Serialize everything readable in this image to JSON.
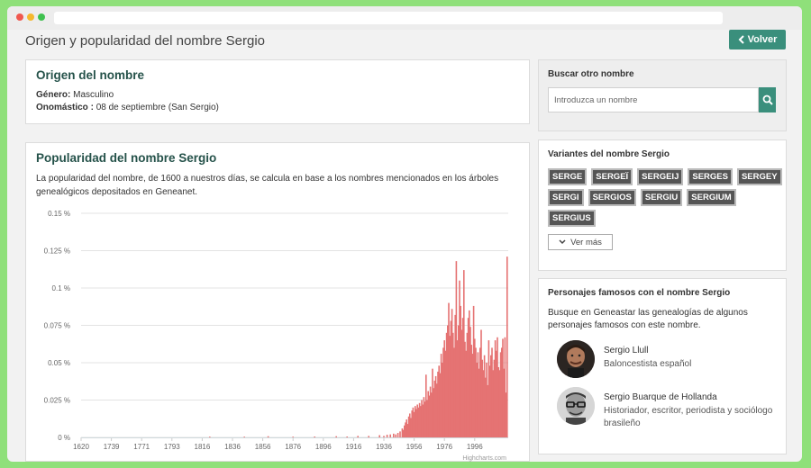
{
  "page": {
    "title": "Origen y popularidad del nombre Sergio",
    "back_label": "Volver"
  },
  "origin": {
    "title": "Origen del nombre",
    "gender_label": "Género:",
    "gender_value": "Masculino",
    "onomastic_label": "Onomástico :",
    "onomastic_value": "08 de septiembre (San Sergio)"
  },
  "popularity": {
    "title": "Popularidad del nombre Sergio",
    "description": "La popularidad del nombre, de 1600 a nuestros días, se calcula en base a los nombres mencionados en los árboles genealógicos depositados en Geneanet.",
    "credit": "Highcharts.com"
  },
  "search": {
    "title": "Buscar otro nombre",
    "placeholder": "Introduzca un nombre"
  },
  "variants": {
    "title": "Variantes del nombre Sergio",
    "items": [
      "SERGE",
      "SERGEÏ",
      "SERGEIJ",
      "SERGES",
      "SERGEY",
      "SERGI",
      "SERGIOS",
      "SERGIU",
      "SERGIUM",
      "SERGIUS"
    ],
    "more_label": "Ver más"
  },
  "famous": {
    "title": "Personajes famosos con el nombre Sergio",
    "description": "Busque en Geneastar las genealogías de algunos personajes famosos con este nombre.",
    "people": [
      {
        "name": "Sergio Llull",
        "desc": "Baloncestista español"
      },
      {
        "name": "Sergio Buarque de Hollanda",
        "desc": "Historiador, escritor, periodista y sociólogo brasileño"
      }
    ]
  },
  "colors": {
    "accent": "#3a8f7c",
    "bar": "#e57373",
    "title": "#25524a"
  },
  "chart_data": {
    "type": "bar",
    "x_range": [
      1620,
      2015
    ],
    "y_range": [
      0,
      0.15
    ],
    "y_ticks": [
      "0 %",
      "0.025 %",
      "0.05 %",
      "0.075 %",
      "0.1 %",
      "0.125 %",
      "0.15 %"
    ],
    "x_ticks": [
      "1620",
      "1739",
      "1771",
      "1793",
      "1816",
      "1836",
      "1856",
      "1876",
      "1896",
      "1916",
      "1936",
      "1956",
      "1976",
      "1996"
    ],
    "series": [
      {
        "values": [
          [
            1739,
            0.0005
          ],
          [
            1771,
            0.0005
          ],
          [
            1793,
            0.0008
          ],
          [
            1816,
            0.0005
          ],
          [
            1836,
            0.0006
          ],
          [
            1856,
            0.0008
          ],
          [
            1866,
            0.0006
          ],
          [
            1876,
            0.001
          ],
          [
            1886,
            0.001
          ],
          [
            1896,
            0.0015
          ],
          [
            1900,
            0.001
          ],
          [
            1903,
            0.0018
          ],
          [
            1906,
            0.002
          ],
          [
            1909,
            0.0025
          ],
          [
            1911,
            0.002
          ],
          [
            1913,
            0.003
          ],
          [
            1915,
            0.004
          ],
          [
            1917,
            0.006
          ],
          [
            1918,
            0.005
          ],
          [
            1919,
            0.008
          ],
          [
            1920,
            0.01
          ],
          [
            1921,
            0.012
          ],
          [
            1922,
            0.009
          ],
          [
            1923,
            0.014
          ],
          [
            1924,
            0.016
          ],
          [
            1925,
            0.013
          ],
          [
            1926,
            0.018
          ],
          [
            1927,
            0.02
          ],
          [
            1928,
            0.017
          ],
          [
            1929,
            0.021
          ],
          [
            1930,
            0.019
          ],
          [
            1931,
            0.022
          ],
          [
            1932,
            0.02
          ],
          [
            1933,
            0.023
          ],
          [
            1934,
            0.021
          ],
          [
            1935,
            0.025
          ],
          [
            1936,
            0.022
          ],
          [
            1937,
            0.027
          ],
          [
            1938,
            0.024
          ],
          [
            1939,
            0.042
          ],
          [
            1940,
            0.025
          ],
          [
            1941,
            0.031
          ],
          [
            1942,
            0.028
          ],
          [
            1943,
            0.034
          ],
          [
            1944,
            0.03
          ],
          [
            1945,
            0.046
          ],
          [
            1946,
            0.033
          ],
          [
            1947,
            0.038
          ],
          [
            1948,
            0.041
          ],
          [
            1949,
            0.036
          ],
          [
            1950,
            0.044
          ],
          [
            1951,
            0.048
          ],
          [
            1952,
            0.043
          ],
          [
            1953,
            0.056
          ],
          [
            1954,
            0.05
          ],
          [
            1955,
            0.06
          ],
          [
            1956,
            0.065
          ],
          [
            1957,
            0.058
          ],
          [
            1958,
            0.07
          ],
          [
            1959,
            0.075
          ],
          [
            1960,
            0.09
          ],
          [
            1961,
            0.068
          ],
          [
            1962,
            0.078
          ],
          [
            1963,
            0.086
          ],
          [
            1964,
            0.07
          ],
          [
            1965,
            0.06
          ],
          [
            1966,
            0.082
          ],
          [
            1967,
            0.118
          ],
          [
            1968,
            0.065
          ],
          [
            1969,
            0.075
          ],
          [
            1970,
            0.105
          ],
          [
            1971,
            0.088
          ],
          [
            1972,
            0.072
          ],
          [
            1973,
            0.08
          ],
          [
            1974,
            0.112
          ],
          [
            1975,
            0.064
          ],
          [
            1976,
            0.058
          ],
          [
            1977,
            0.07
          ],
          [
            1978,
            0.08
          ],
          [
            1979,
            0.085
          ],
          [
            1980,
            0.074
          ],
          [
            1981,
            0.062
          ],
          [
            1982,
            0.056
          ],
          [
            1983,
            0.088
          ],
          [
            1984,
            0.066
          ],
          [
            1985,
            0.06
          ],
          [
            1986,
            0.05
          ],
          [
            1987,
            0.057
          ],
          [
            1988,
            0.046
          ],
          [
            1989,
            0.06
          ],
          [
            1990,
            0.072
          ],
          [
            1991,
            0.052
          ],
          [
            1992,
            0.045
          ],
          [
            1993,
            0.055
          ],
          [
            1994,
            0.04
          ],
          [
            1995,
            0.05
          ],
          [
            1996,
            0.035
          ],
          [
            1997,
            0.065
          ],
          [
            1998,
            0.048
          ],
          [
            1999,
            0.055
          ],
          [
            2000,
            0.06
          ],
          [
            2001,
            0.045
          ],
          [
            2002,
            0.052
          ],
          [
            2003,
            0.065
          ],
          [
            2004,
            0.058
          ],
          [
            2005,
            0.067
          ],
          [
            2006,
            0.047
          ],
          [
            2007,
            0.045
          ],
          [
            2008,
            0.057
          ],
          [
            2009,
            0.06
          ],
          [
            2010,
            0.066
          ],
          [
            2011,
            0.046
          ],
          [
            2012,
            0.067
          ],
          [
            2013,
            0.03
          ],
          [
            2014,
            0.121
          ]
        ]
      }
    ]
  }
}
